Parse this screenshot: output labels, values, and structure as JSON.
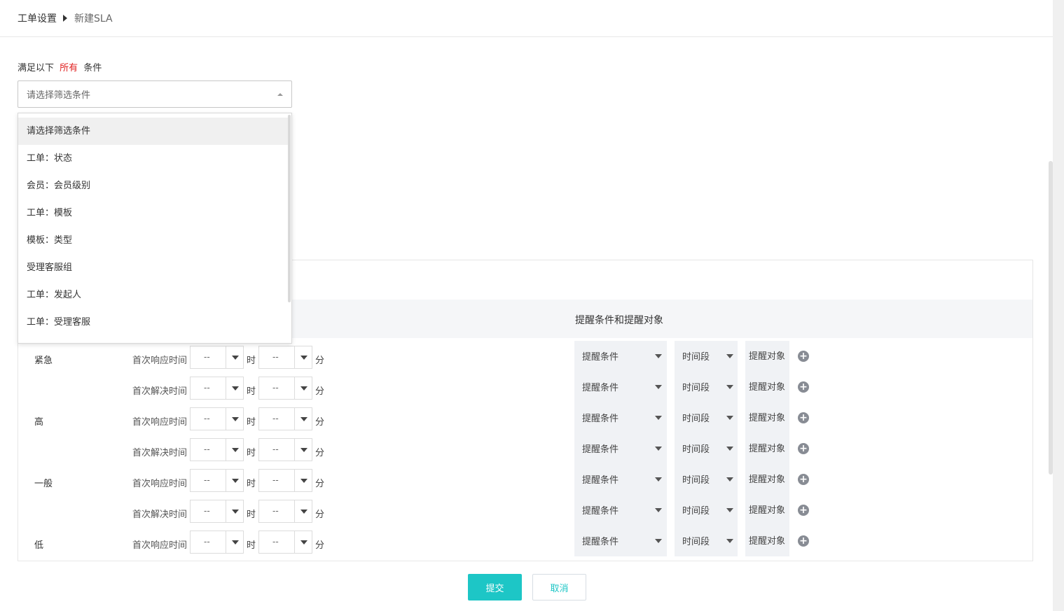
{
  "breadcrumb": {
    "parent": "工单设置",
    "current": "新建SLA"
  },
  "condition": {
    "prefix": "满足以下",
    "emphasis": "所有",
    "suffix": "条件",
    "select_placeholder": "请选择筛选条件",
    "options": [
      "请选择筛选条件",
      "工单：状态",
      "会员：会员级别",
      "工单：模板",
      "模板：类型",
      "受理客服组",
      "工单：发起人",
      "工单：受理客服"
    ]
  },
  "table": {
    "remind_header": "提醒条件和提醒对象",
    "hour_unit": "时",
    "minute_unit": "分",
    "time_placeholder": "--",
    "remind_condition": "提醒条件",
    "time_period": "时间段",
    "remind_target": "提醒对象",
    "plus": "+",
    "rows": [
      {
        "priority": "紧急",
        "label": "首次响应时间"
      },
      {
        "priority": "",
        "label": "首次解决时间"
      },
      {
        "priority": "高",
        "label": "首次响应时间"
      },
      {
        "priority": "",
        "label": "首次解决时间"
      },
      {
        "priority": "一般",
        "label": "首次响应时间"
      },
      {
        "priority": "",
        "label": "首次解决时间"
      },
      {
        "priority": "低",
        "label": "首次响应时间"
      }
    ]
  },
  "actions": {
    "submit": "提交",
    "cancel": "取消"
  },
  "colors": {
    "accent": "#1dc6c6",
    "emphasis": "#e02020"
  }
}
